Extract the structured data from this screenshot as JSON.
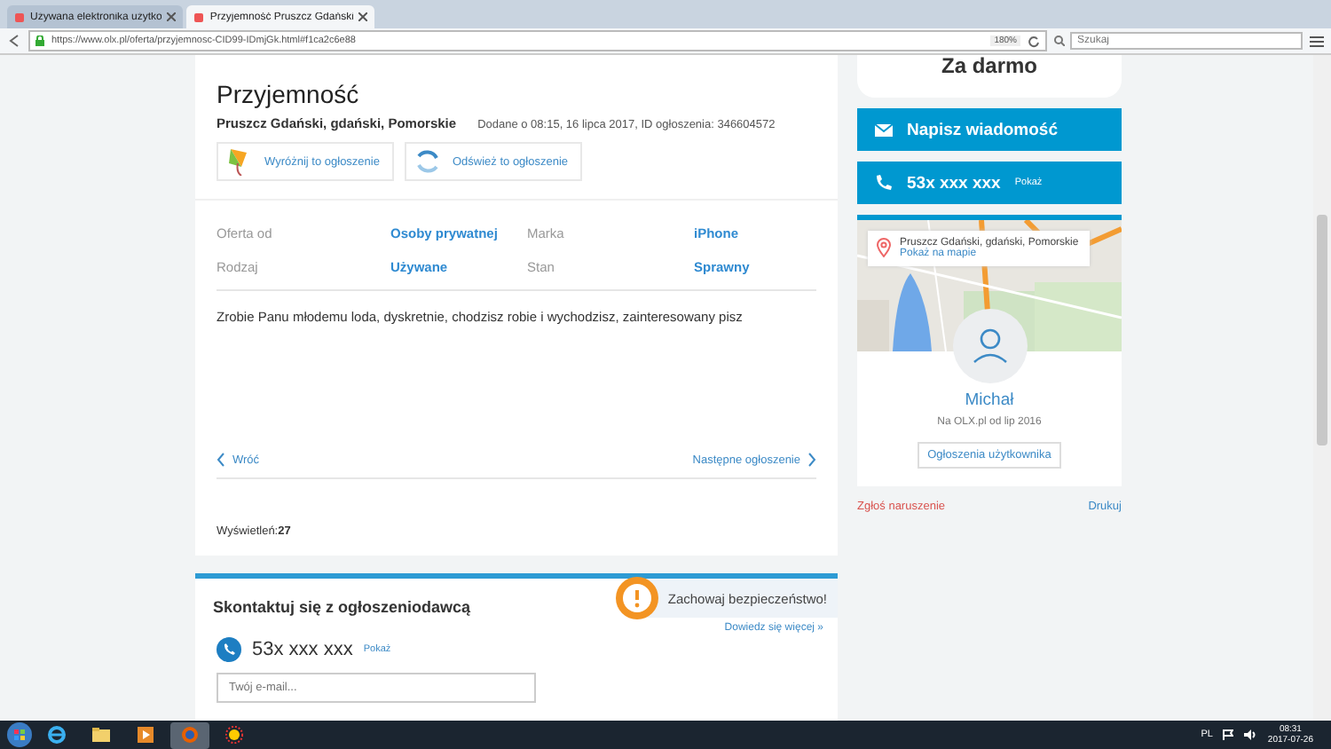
{
  "browser": {
    "tabs": [
      {
        "label": "Używana elektronika użytko",
        "selected": false
      },
      {
        "label": "Przyjemność Pruszcz Gdański",
        "selected": true
      }
    ],
    "url": "https://www.olx.pl/oferta/przyjemnosc-CID99-IDmjGk.html#f1ca2c6e88",
    "zoom": "180%",
    "search_placeholder": "Szukaj"
  },
  "ad": {
    "title": "Przyjemność",
    "location": "Pruszcz Gdański, gdański, Pomorskie",
    "added": "Dodane o 08:15, 16 lipca 2017, ID ogłoszenia: 346604572",
    "actions": [
      {
        "label": "Wyróżnij to ogłoszenie",
        "kind": "promote"
      },
      {
        "label": "Odśwież to ogłoszenie",
        "kind": "refresh"
      }
    ],
    "details": [
      {
        "label": "Oferta od",
        "value": "Osoby prywatnej"
      },
      {
        "label": "Marka",
        "value": "iPhone"
      },
      {
        "label": "Rodzaj",
        "value": "Używane"
      },
      {
        "label": "Stan",
        "value": "Sprawny"
      }
    ],
    "description": "Zrobie Panu młodemu loda, dyskretnie, chodzisz robie i wychodzisz, zainteresowany pisz",
    "back": "Wróć",
    "next": "Następne ogłoszenie",
    "views": "Wyświetleń:**27**"
  },
  "contact": {
    "title": "Skontaktuj się z ogłoszeniodawcą",
    "safety": "Zachowaj bezpieczeństwo!",
    "learn_more": "Dowiedz się więcej »",
    "phone": "53x xxx xxx",
    "show": "Pokaż",
    "email_placeholder": "Twój e-mail..."
  },
  "sidebar": {
    "price": "Za darmo",
    "message_button": "Napisz wiadomość",
    "phone": "53x xxx xxx",
    "show": "Pokaż",
    "map_location": "Pruszcz Gdański, gdański, Pomorskie",
    "map_link": "Pokaż na mapie",
    "user_name": "Michał",
    "member_since": "Na OLX.pl od lip 2016",
    "user_ads_button": "Ogłoszenia użytkownika",
    "report": "Zgłoś naruszenie",
    "print": "Drukuj"
  },
  "taskbar": {
    "apps": [
      {
        "kind": "ie",
        "selected": false
      },
      {
        "kind": "folder",
        "selected": false
      },
      {
        "kind": "media",
        "selected": false
      },
      {
        "kind": "firefox",
        "selected": true
      },
      {
        "kind": "sun",
        "selected": false
      }
    ],
    "language": "PL",
    "time": "08:31",
    "date": "2017-07-26"
  }
}
